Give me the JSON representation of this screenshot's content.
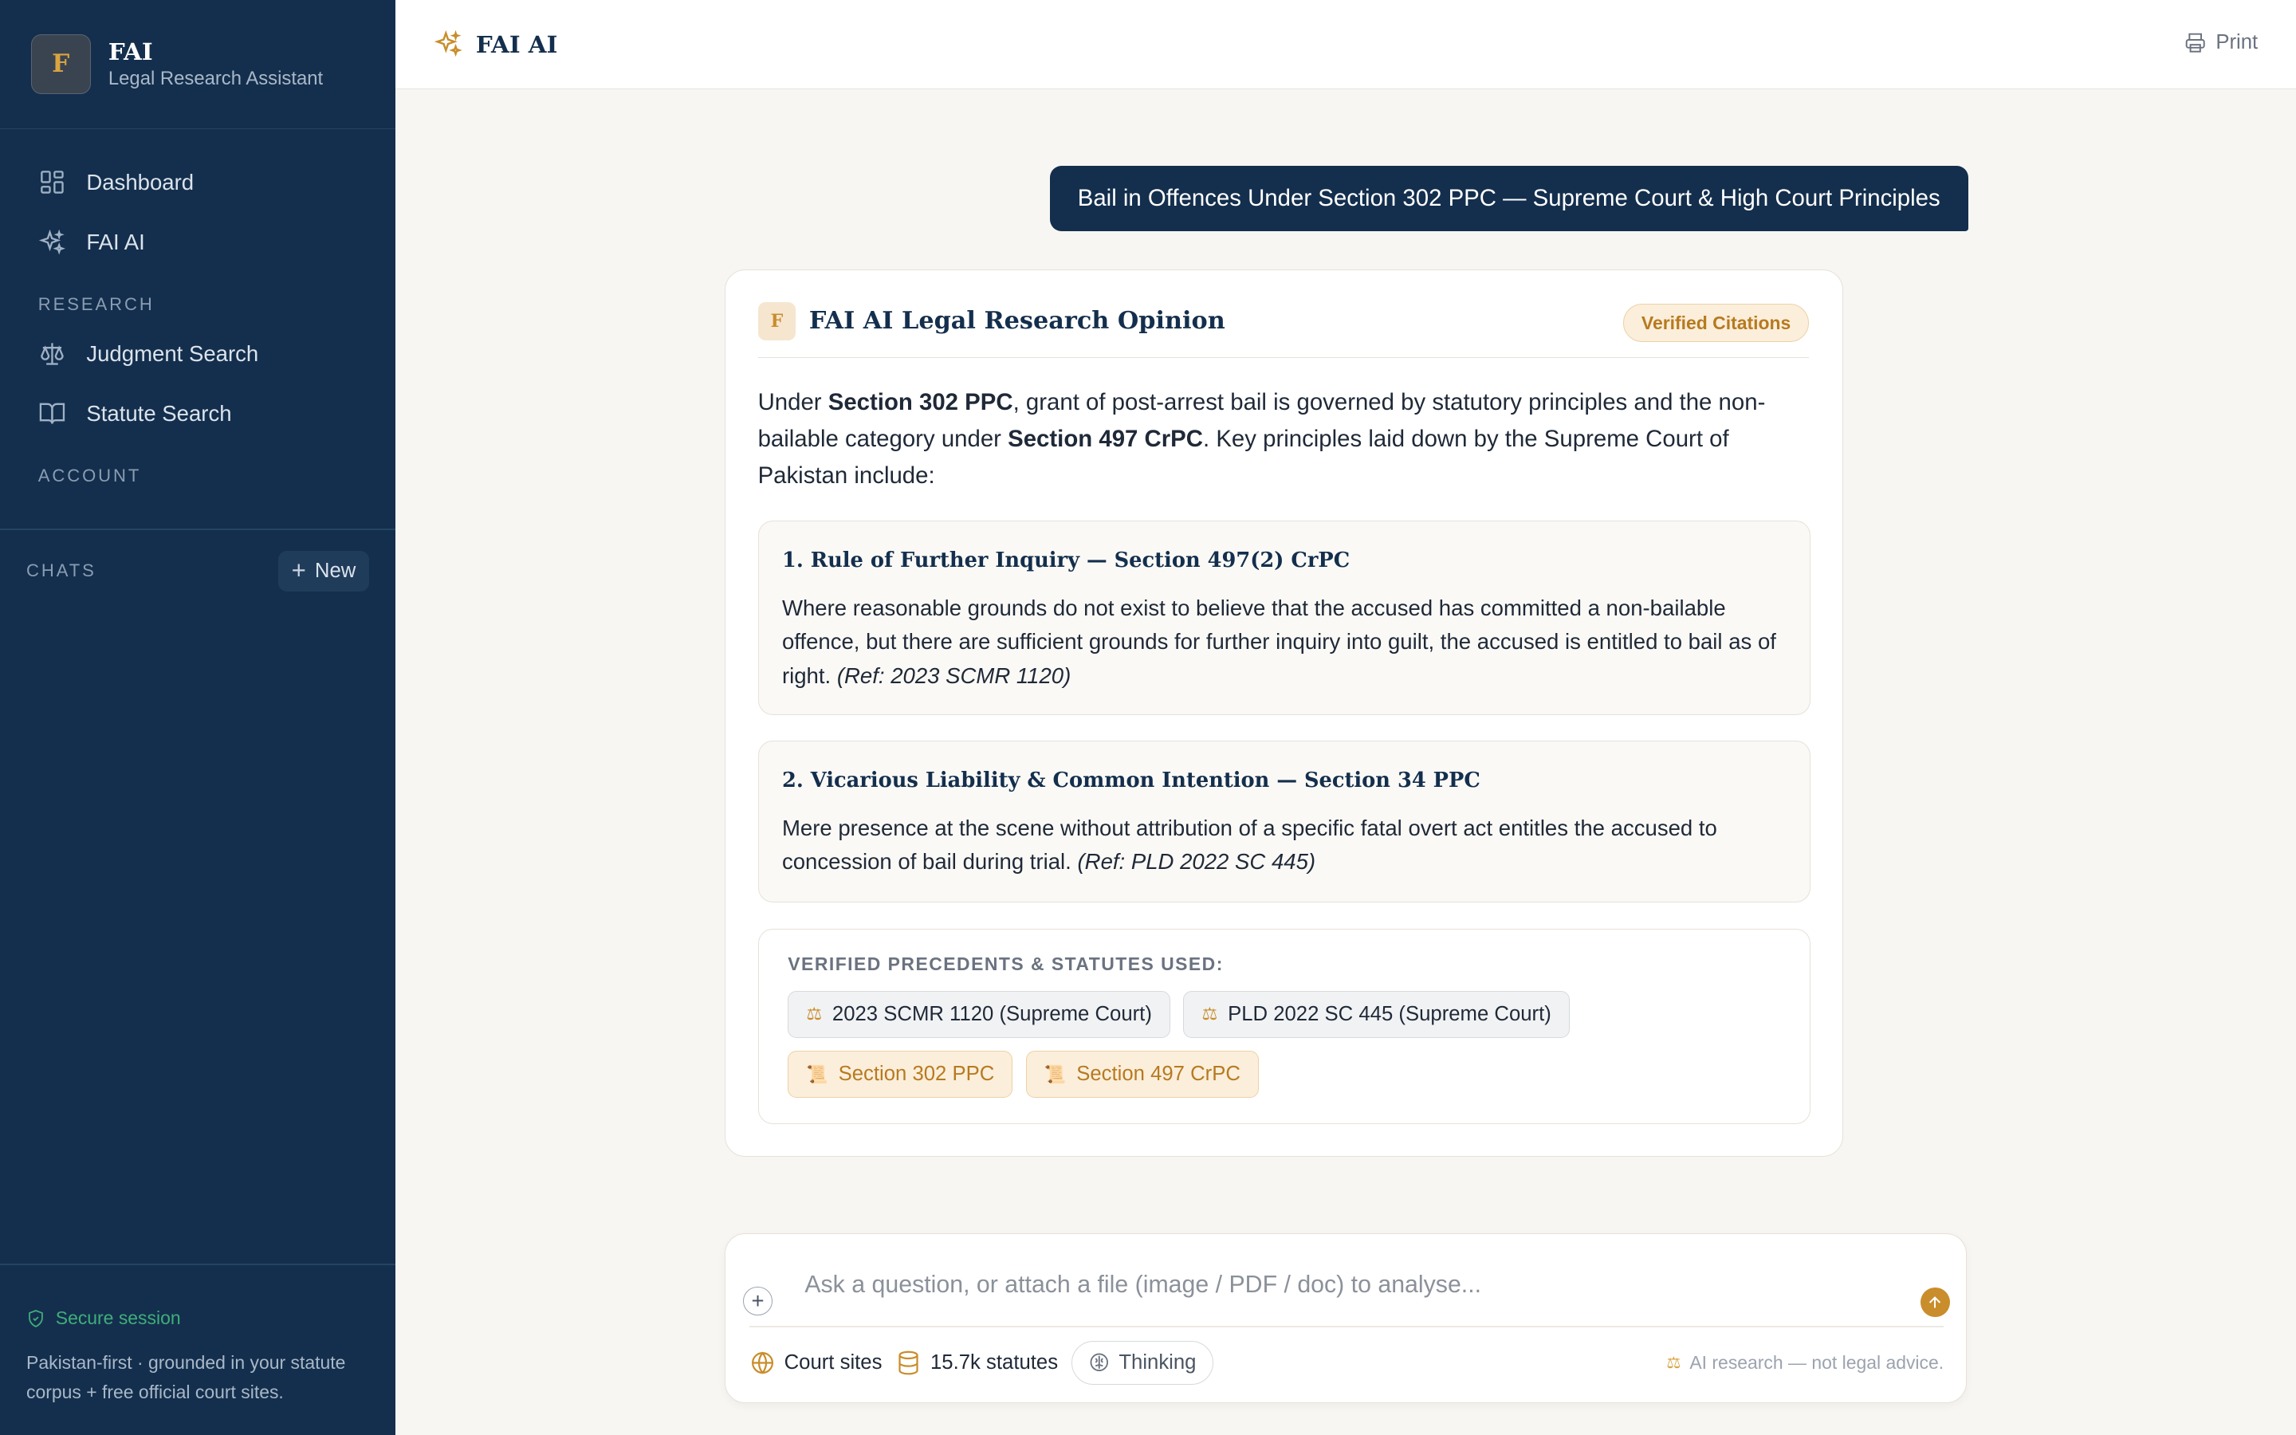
{
  "brand": {
    "logo_letter": "F",
    "name": "FAI",
    "subtitle": "Legal Research Assistant"
  },
  "sidebar": {
    "nav": [
      {
        "label": "Dashboard",
        "icon": "dashboard-icon"
      },
      {
        "label": "FAI AI",
        "icon": "sparkles-icon"
      }
    ],
    "research_label": "RESEARCH",
    "research": [
      {
        "label": "Judgment Search",
        "icon": "scales-icon"
      },
      {
        "label": "Statute Search",
        "icon": "book-icon"
      }
    ],
    "account_label": "ACCOUNT",
    "chats_label": "CHATS",
    "new_label": "New",
    "secure_label": "Secure session",
    "footer_note": "Pakistan-first · grounded in your statute corpus + free official court sites."
  },
  "topbar": {
    "title": "FAI AI",
    "print_label": "Print"
  },
  "user_message": "Bail in Offences Under Section 302 PPC — Supreme Court & High Court Principles",
  "opinion": {
    "badge_letter": "F",
    "title": "FAI AI Legal Research Opinion",
    "verified_label": "Verified Citations",
    "intro": {
      "p1": "Under ",
      "b1": "Section 302 PPC",
      "p2": ", grant of post-arrest bail is governed by statutory principles and the non-bailable category under ",
      "b2": "Section 497 CrPC",
      "p3": ". Key principles laid down by the Supreme Court of Pakistan include:"
    },
    "principles": [
      {
        "title": "1. Rule of Further Inquiry — Section 497(2) CrPC",
        "text": "Where reasonable grounds do not exist to believe that the accused has committed a non-bailable offence, but there are sufficient grounds for further inquiry into guilt, the accused is entitled to bail as of right.",
        "ref": "(Ref: 2023 SCMR 1120)"
      },
      {
        "title": "2. Vicarious Liability & Common Intention — Section 34 PPC",
        "text": "Mere presence at the scene without attribution of a specific fatal overt act entitles the accused to concession of bail during trial.",
        "ref": "(Ref: PLD 2022 SC 445)"
      }
    ],
    "used_label": "VERIFIED PRECEDENTS & STATUTES USED:",
    "cases": [
      "2023 SCMR 1120 (Supreme Court)",
      "PLD 2022 SC 445 (Supreme Court)"
    ],
    "statutes": [
      "Section 302 PPC",
      "Section 497 CrPC"
    ]
  },
  "composer": {
    "placeholder": "Ask a question, or attach a file (image / PDF / doc) to analyse...",
    "court_sites_label": "Court sites",
    "statutes_label": "15.7k statutes",
    "thinking_label": "Thinking",
    "disclaimer": "AI research — not legal advice."
  },
  "colors": {
    "sidebar_bg": "#142f4d",
    "accent": "#c98d2b",
    "success": "#3fae7a"
  }
}
